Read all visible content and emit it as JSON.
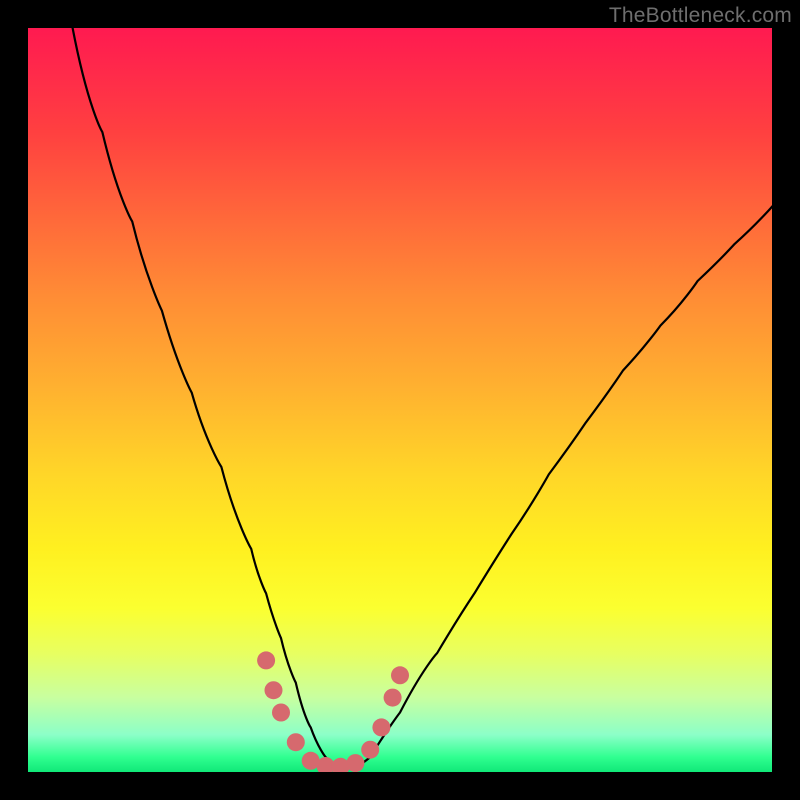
{
  "watermark": {
    "text": "TheBottleneck.com"
  },
  "colors": {
    "frame": "#000000",
    "curve": "#000000",
    "marker": "#d6696e",
    "gradient_top": "#ff1a50",
    "gradient_bottom": "#10e878"
  },
  "chart_data": {
    "type": "line",
    "title": "",
    "xlabel": "",
    "ylabel": "",
    "xlim": [
      0,
      100
    ],
    "ylim": [
      0,
      100
    ],
    "grid": false,
    "legend": null,
    "series": [
      {
        "name": "bottleneck-curve",
        "x": [
          6,
          10,
          14,
          18,
          22,
          26,
          30,
          32,
          34,
          36,
          38,
          40,
          42,
          44,
          46,
          50,
          55,
          60,
          65,
          70,
          75,
          80,
          85,
          90,
          95,
          100
        ],
        "y": [
          100,
          86,
          74,
          62,
          51,
          41,
          30,
          24,
          18,
          12,
          6,
          2,
          0.5,
          0.5,
          2,
          8,
          16,
          24,
          32,
          40,
          47,
          54,
          60,
          66,
          71,
          76
        ]
      }
    ],
    "markers": {
      "name": "low-region-dots",
      "color": "#d6696e",
      "points": [
        {
          "x": 32,
          "y": 15
        },
        {
          "x": 33,
          "y": 11
        },
        {
          "x": 34,
          "y": 8
        },
        {
          "x": 36,
          "y": 4
        },
        {
          "x": 38,
          "y": 1.5
        },
        {
          "x": 40,
          "y": 0.8
        },
        {
          "x": 42,
          "y": 0.7
        },
        {
          "x": 44,
          "y": 1.2
        },
        {
          "x": 46,
          "y": 3
        },
        {
          "x": 47.5,
          "y": 6
        },
        {
          "x": 49,
          "y": 10
        },
        {
          "x": 50,
          "y": 13
        }
      ]
    }
  }
}
